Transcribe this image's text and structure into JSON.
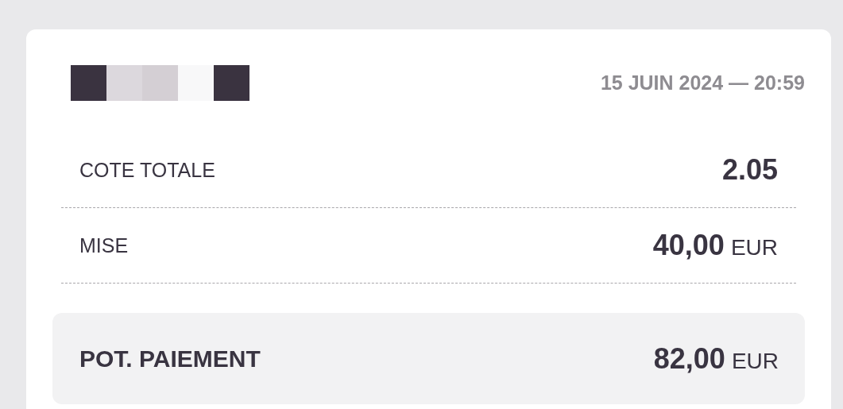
{
  "date": "15 JUIN 2024 — 20:59",
  "rows": [
    {
      "label": "COTE TOTALE",
      "value": "2.05"
    },
    {
      "label": "MISE",
      "value": "40,00",
      "currency": "EUR"
    }
  ],
  "payout": {
    "label": "POT. PAIEMENT",
    "value": "82,00",
    "currency": "EUR"
  }
}
